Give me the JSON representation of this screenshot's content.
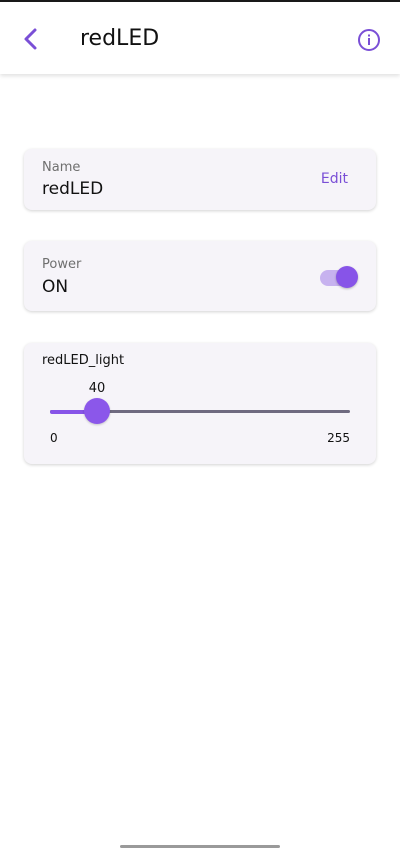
{
  "header": {
    "title": "redLED",
    "back_icon": "back-arrow-icon",
    "info_icon": "info-icon",
    "accent": "#7a4fd6"
  },
  "name_card": {
    "label": "Name",
    "value": "redLED",
    "edit_label": "Edit"
  },
  "power_card": {
    "label": "Power",
    "value": "ON",
    "toggle_on": true
  },
  "slider_card": {
    "title": "redLED_light",
    "value": 40,
    "value_label": "40",
    "min": 0,
    "max": 255,
    "min_label": "0",
    "max_label": "255"
  }
}
